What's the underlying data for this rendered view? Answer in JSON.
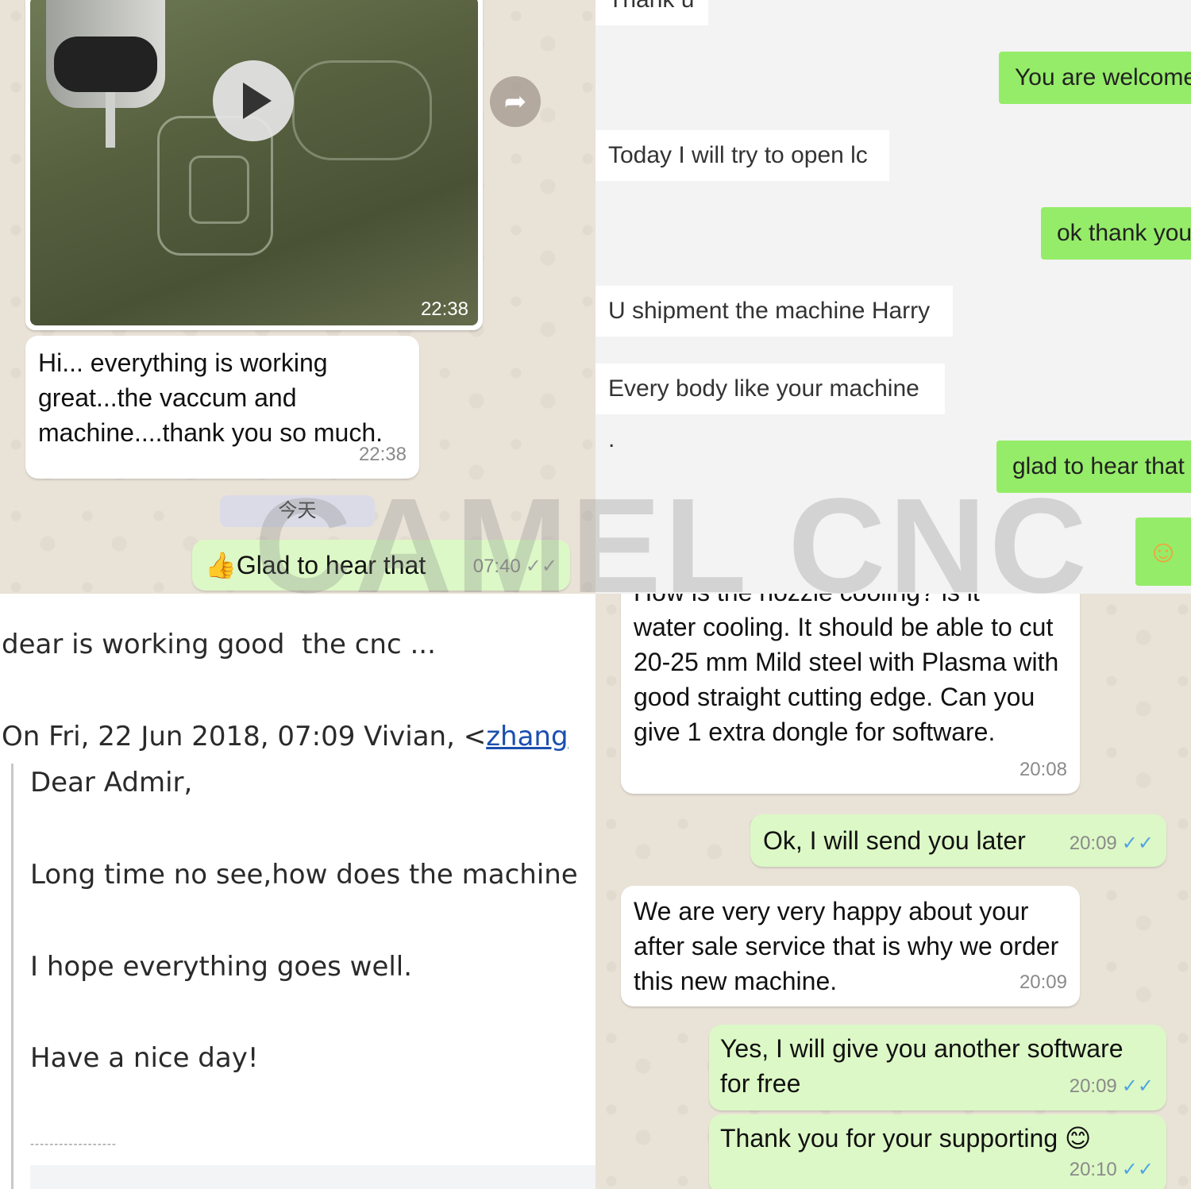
{
  "top_left": {
    "video_time": "22:38",
    "incoming_text": "Hi... everything is working great...the vaccum and machine....thank you so much.",
    "incoming_time": "22:38",
    "date_chip": "今天",
    "outgoing_text": "Glad to hear that",
    "outgoing_emoji": "👍",
    "outgoing_time": "07:40"
  },
  "top_right": {
    "partial_top": "Thank u",
    "messages": [
      {
        "side": "right",
        "text": "You are welcome"
      },
      {
        "side": "left",
        "text": "Today I will try to open lc"
      },
      {
        "side": "right",
        "text": "ok thank you"
      },
      {
        "side": "left",
        "text": "U shipment the machine Harry"
      },
      {
        "side": "left",
        "text": "Every body like your machine ."
      },
      {
        "side": "right",
        "text": "glad to hear that"
      }
    ],
    "emoji": "☺"
  },
  "bottom_left": {
    "reply_line": "dear is working good  the cnc ...",
    "quote_header": "On Fri, 22 Jun 2018, 07:09 Vivian, <",
    "quote_link": "zhang",
    "greeting": "Dear Admir,",
    "line1": "Long time no see,how does the machine",
    "line2": "I hope everything goes well.",
    "line3": "Have a nice day!",
    "separator": "------------------"
  },
  "bottom_right": {
    "partial_top": "How is the nozzle cooling? is it",
    "msg1": "water cooling. It should be able to cut 20-25 mm Mild steel with Plasma with good straight cutting edge. Can you give 1 extra dongle for software.",
    "msg1_time": "20:08",
    "msg2": "Ok, I will send you later",
    "msg2_time": "20:09",
    "msg3": "We are very very happy about your after sale service that is why we order this new machine.",
    "msg3_time": "20:09",
    "msg4": "Yes, I will give you another software for free",
    "msg4_time": "20:09",
    "msg5": "Thank you for your supporting",
    "msg5_emoji": "😊",
    "msg5_time": "20:10"
  },
  "watermark": "CAMEL CNC",
  "colors": {
    "wa_outgoing": "#dcf8c6",
    "wechat_green": "#95ec69",
    "read_ticks": "#4fa3e6",
    "link": "#1a4fb0"
  }
}
